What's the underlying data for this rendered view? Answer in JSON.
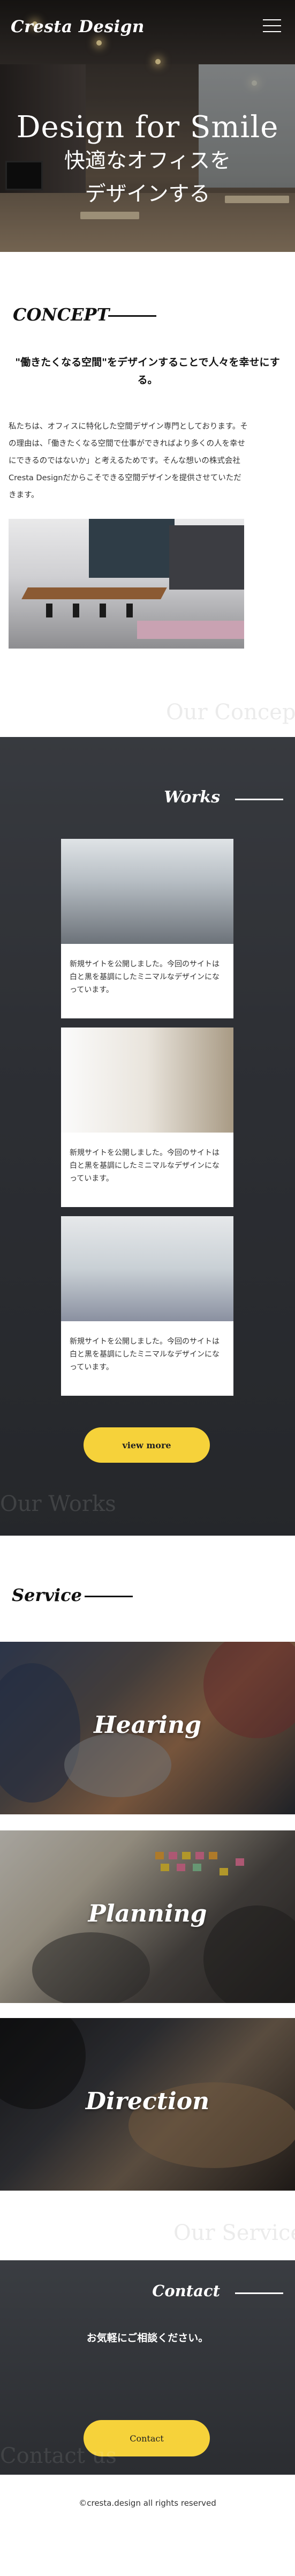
{
  "header": {
    "logo": "Cresta Design",
    "menu_icon": "hamburger-menu-icon"
  },
  "hero": {
    "title_en": "Design for Smile",
    "title_jp_line1": "快適なオフィスを",
    "title_jp_line2": "デザインする"
  },
  "concept": {
    "title": "CONCEPT",
    "lead": "\"働きたくなる空間\"をデザインすることで人々を幸せにする。",
    "body": "私たちは、オフィスに特化した空間デザイン専門としております。その理由は、「働きたくなる空間で仕事ができればより多くの人を幸せにできるのではないか」と考えるためです。そんな想いの株式会社Cresta Designだからこそできる空間デザインを提供させていただきます。",
    "watermark": "Our Concept"
  },
  "works": {
    "title": "Works",
    "items": [
      {
        "text": "新規サイトを公開しました。今回のサイトは白と黒を基調にしたミニマルなデザインになっています。"
      },
      {
        "text": "新規サイトを公開しました。今回のサイトは白と黒を基調にしたミニマルなデザインになっています。"
      },
      {
        "text": "新規サイトを公開しました。今回のサイトは白と黒を基調にしたミニマルなデザインになっています。"
      }
    ],
    "view_more": "view more",
    "watermark": "Our Works"
  },
  "service": {
    "title": "Service",
    "items": [
      {
        "label": "Hearing"
      },
      {
        "label": "Planning"
      },
      {
        "label": "Direction"
      }
    ],
    "watermark": "Our Service"
  },
  "contact": {
    "title": "Contact",
    "message": "お気軽にご相談ください。",
    "button": "Contact",
    "watermark": "Contact us"
  },
  "footer": {
    "copyright": "©cresta.design all rights reserved"
  },
  "colors": {
    "accent": "#f6d23a",
    "dark": "#2f3236"
  }
}
